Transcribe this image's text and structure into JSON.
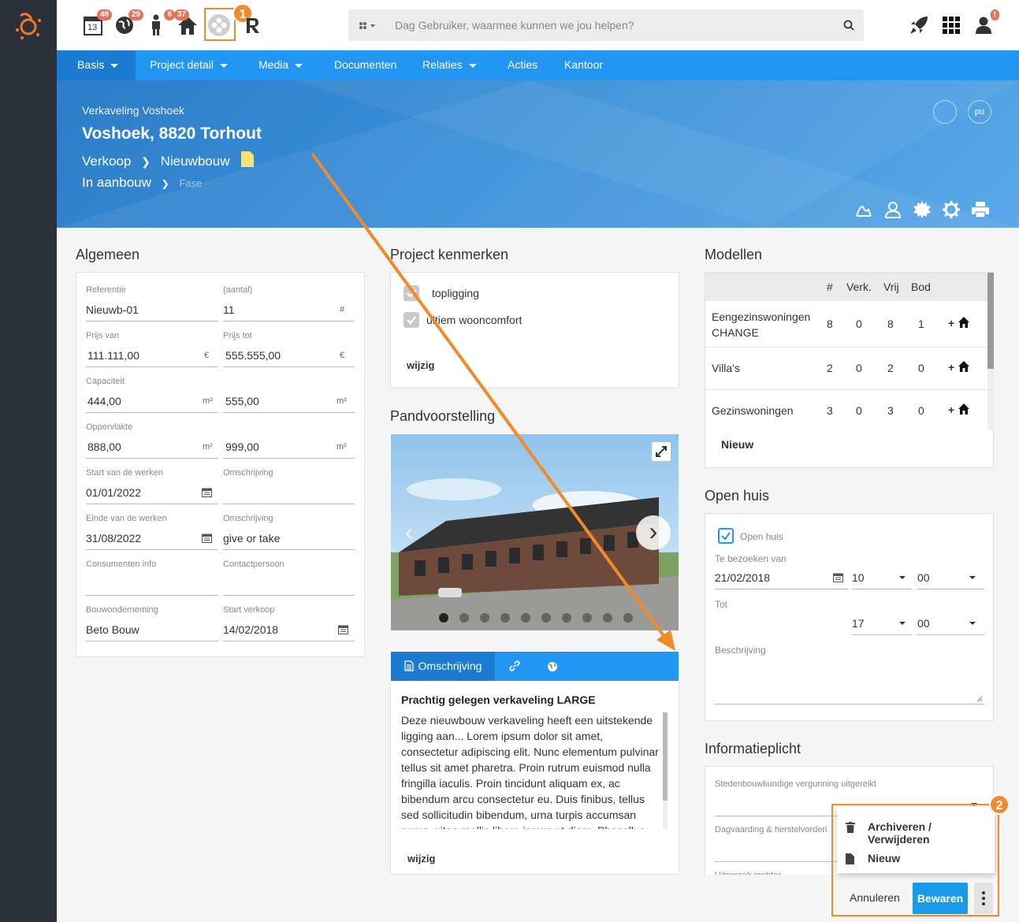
{
  "badges": {
    "calendar": "48",
    "globe": "29",
    "person": "6",
    "house": "37"
  },
  "calendar_day": "13",
  "callouts": [
    "1",
    "2"
  ],
  "search": {
    "placeholder": "Dag Gebruiker, waarmee kunnen we jou helpen?"
  },
  "user_alert": "!",
  "nav": [
    {
      "label": "Basis",
      "caret": true,
      "active": true
    },
    {
      "label": "Project detail",
      "caret": true
    },
    {
      "label": "Media",
      "caret": true
    },
    {
      "label": "Documenten"
    },
    {
      "label": "Relaties",
      "caret": true
    },
    {
      "label": "Acties"
    },
    {
      "label": "Kantoor"
    }
  ],
  "hero": {
    "subtitle": "Verkaveling Voshoek",
    "title": "Voshoek, 8820 Torhout",
    "type": "Verkoop",
    "subtype": "Nieuwbouw",
    "status": "In aanbouw",
    "fase": "Fase",
    "avatar_initials": "pu"
  },
  "algemeen": {
    "title": "Algemeen",
    "fields": {
      "referentie": {
        "label": "Referentie",
        "value": "Nieuwb-01"
      },
      "aantal": {
        "label": "(aantal)",
        "value": "11",
        "unit": "#"
      },
      "prijs_van": {
        "label": "Prijs van",
        "value": "111.111,00",
        "unit": "€"
      },
      "prijs_tot": {
        "label": "Prijs tot",
        "value": "555.555,00",
        "unit": "€"
      },
      "capaciteit": {
        "label": "Capaciteit",
        "value": "444,00",
        "unit": "m³"
      },
      "capaciteit2": {
        "value": "555,00",
        "unit": "m³"
      },
      "oppervlakte": {
        "label": "Oppervlakte",
        "value": "888,00",
        "unit": "m²"
      },
      "oppervlakte2": {
        "value": "999,00",
        "unit": "m²"
      },
      "start_werken": {
        "label": "Start van de werken",
        "value": "01/01/2022"
      },
      "omschrijving1": {
        "label": "Omschrijving",
        "value": ""
      },
      "einde_werken": {
        "label": "Einde van de werken",
        "value": "31/08/2022"
      },
      "omschrijving2": {
        "label": "Omschrijving",
        "value": "give or take"
      },
      "consumenten": {
        "label": "Consumenten info",
        "value": ""
      },
      "contactpersoon": {
        "label": "Contactpersoon",
        "value": ""
      },
      "bouwonderneming": {
        "label": "Bouwonderneming",
        "value": "Beto Bouw"
      },
      "start_verkoop": {
        "label": "Start verkoop",
        "value": "14/02/2018"
      }
    }
  },
  "kenmerken": {
    "title": "Project kenmerken",
    "items": [
      "topligging",
      "ultiem wooncomfort"
    ],
    "edit": "wijzig"
  },
  "pandvoorstelling": {
    "title": "Pandvoorstelling",
    "slides": 10,
    "active_slide": 1
  },
  "omschrijving": {
    "tabs": [
      "Omschrijving"
    ],
    "heading": "Prachtig gelegen verkaveling LARGE",
    "text": "Deze nieuwbouw verkaveling heeft een uitstekende ligging aan... Lorem ipsum dolor sit amet, consectetur adipiscing elit. Nunc elementum pulvinar tellus sit amet pharetra. Proin rutrum euismod nulla fringilla iaculis. Proin tincidunt aliquam ex, ac bibendum arcu consectetur eu. Duis finibus, tellus sed sollicitudin bibendum, urna turpis accumsan purus, vitae mollis libero ipsum ut diam. Phasellus dapibus id elit blandit",
    "edit": "wijzig"
  },
  "modellen": {
    "title": "Modellen",
    "headers": [
      "#",
      "Verk.",
      "Vrij",
      "Bod"
    ],
    "rows": [
      {
        "name": "Eengezinswoningen CHANGE",
        "count": "8",
        "verk": "0",
        "vrij": "8",
        "bod": "1"
      },
      {
        "name": "Villa's",
        "count": "2",
        "verk": "0",
        "vrij": "2",
        "bod": "0"
      },
      {
        "name": "Gezinswoningen",
        "count": "3",
        "verk": "0",
        "vrij": "3",
        "bod": "0"
      }
    ],
    "new": "Nieuw",
    "plus": "+"
  },
  "open_huis": {
    "title": "Open huis",
    "checkbox_label": "Open huis",
    "van_label": "Te bezoeken van",
    "date": "21/02/2018",
    "from_hour": "10",
    "from_min": "00",
    "tot_label": "Tot",
    "to_hour": "17",
    "to_min": "00",
    "beschrijving_label": "Beschrijving"
  },
  "informatieplicht": {
    "title": "Informatieplicht",
    "f1": "Stedenbouwkundige vergunning uitgereikt",
    "f2": "Dagvaarding & herstelvorderi",
    "f3": "Uitspraak rechter"
  },
  "menu": {
    "archive": "Archiveren / Verwijderen",
    "new": "Nieuw"
  },
  "footer": {
    "cancel": "Annuleren",
    "save": "Bewaren"
  },
  "colors": {
    "accent": "#2196f3",
    "callout": "#f08b2c",
    "badge": "#e57357"
  }
}
